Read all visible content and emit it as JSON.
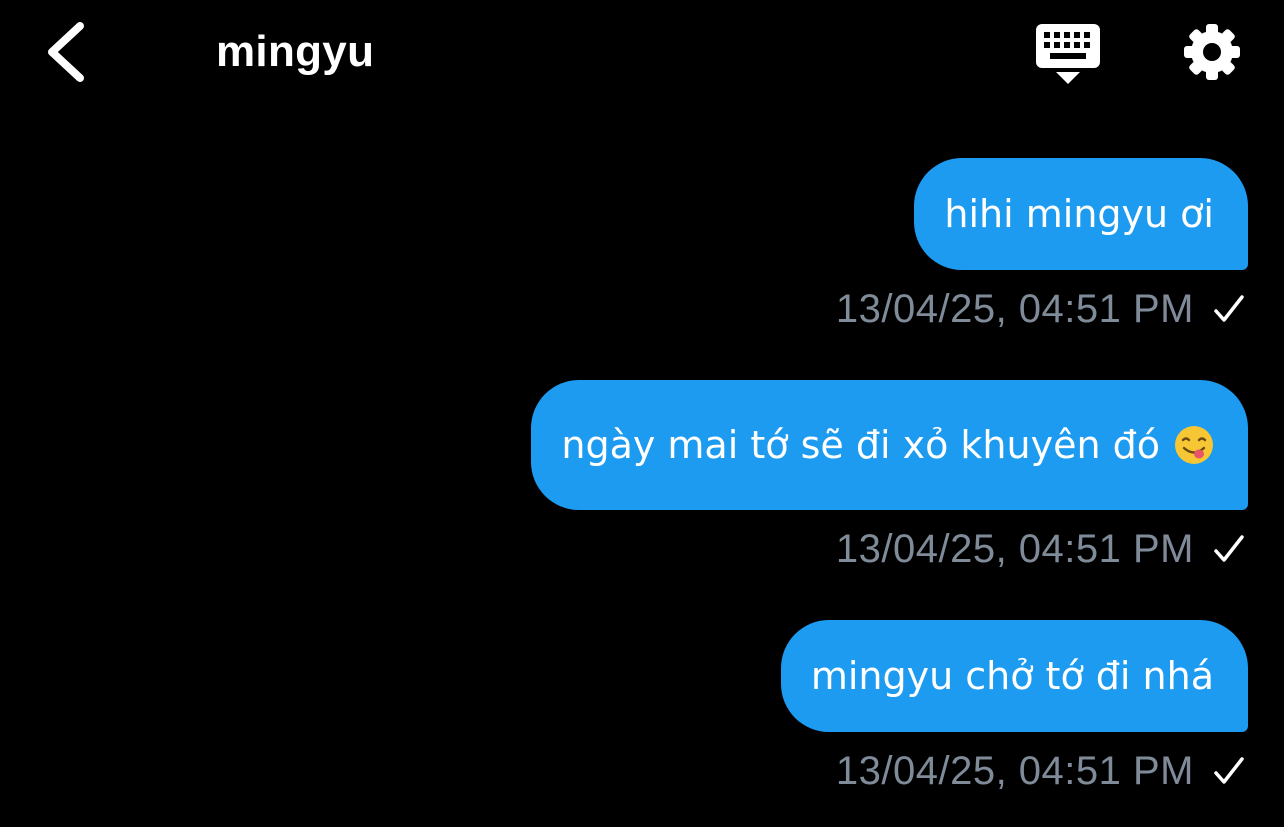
{
  "header": {
    "title": "mingyu",
    "back_icon": "chevron-left-icon",
    "keyboard_icon": "keyboard-icon",
    "settings_icon": "gear-icon"
  },
  "messages": [
    {
      "text": "hihi mingyu ơi",
      "timestamp": "13/04/25, 04:51 PM",
      "status": "sent-check"
    },
    {
      "text": "ngày mai tớ sẽ đi xỏ khuyên đó",
      "emoji": "face-savoring-food-emoji",
      "timestamp": "13/04/25, 04:51 PM",
      "status": "sent-check"
    },
    {
      "text": "mingyu chở tớ đi nhá",
      "timestamp": "13/04/25, 04:51 PM",
      "status": "sent-check"
    }
  ],
  "colors": {
    "background": "#000000",
    "bubble": "#1d9bf0",
    "timestamp": "#7f8b98",
    "text": "#ffffff"
  }
}
